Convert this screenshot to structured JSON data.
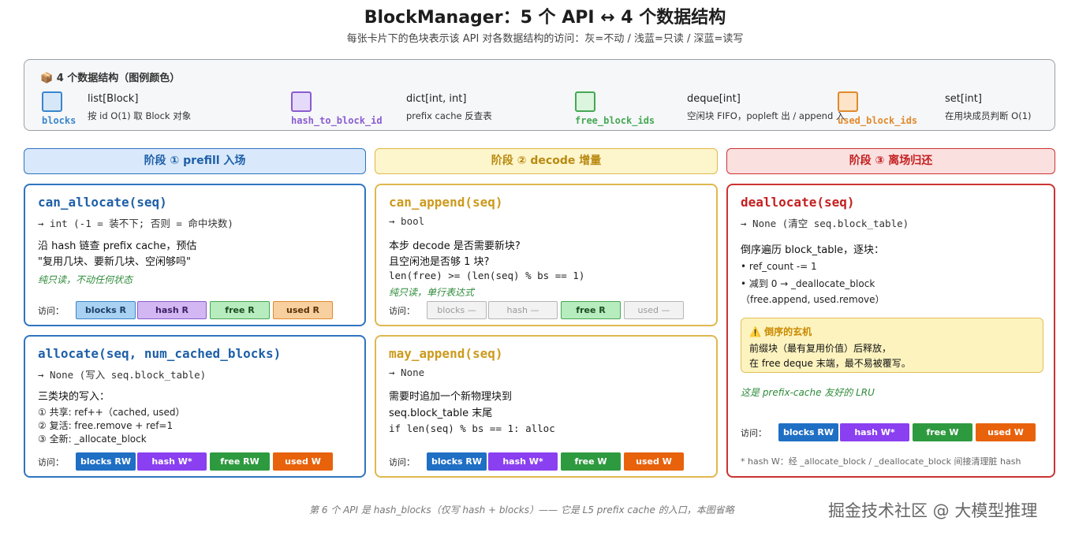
{
  "header": {
    "title": "BlockManager：5 个 API ↔ 4 个数据结构",
    "subtitle": "每张卡片下的色块表示该 API 对各数据结构的访问：灰=不动 / 浅蓝=只读 / 深蓝=读写"
  },
  "legend": {
    "title": "📦 4 个数据结构（图例颜色）",
    "items": [
      {
        "name": "blocks",
        "type": "list[Block]",
        "desc": "按 id O(1) 取 Block 对象",
        "color": "#3a86cc",
        "fill": "#d6e8f8"
      },
      {
        "name": "hash_to_block_id",
        "type": "dict[int, int]",
        "desc": "prefix cache 反查表",
        "color": "#8a5cd0",
        "fill": "#e6dafa"
      },
      {
        "name": "free_block_ids",
        "type": "deque[int]",
        "desc": "空闲块 FIFO，popleft 出 / append 入",
        "color": "#45a853",
        "fill": "#dcf5df"
      },
      {
        "name": "used_block_ids",
        "type": "set[int]",
        "desc": "在用块成员判断 O(1)",
        "color": "#e08a2c",
        "fill": "#fde3c8"
      }
    ]
  },
  "phases": [
    {
      "label": "阶段 ① prefill 入场",
      "color": "#2f74c0",
      "bg": "#d9e9fb",
      "text_color": "#1e5fa8"
    },
    {
      "label": "阶段 ② decode 增量",
      "color": "#e0b850",
      "bg": "#fdf5cc",
      "text_color": "#b98a12"
    },
    {
      "label": "阶段 ③ 离场归还",
      "color": "#cc3333",
      "bg": "#fbe0e0",
      "text_color": "#c42020"
    }
  ],
  "access_label": "访问：",
  "cards": {
    "can_allocate": {
      "fn": "can_allocate(seq)",
      "ret": "→ int (-1 = 装不下; 否则 = 命中块数)",
      "line1": "沿 hash 链查 prefix cache，预估",
      "line2": "\"复用几块、要新几块、空闲够吗\"",
      "note": "纯只读，不动任何状态",
      "chips": [
        "blocks R",
        "hash R",
        "free R",
        "used R"
      ]
    },
    "allocate": {
      "fn": "allocate(seq, num_cached_blocks)",
      "ret": "→ None (写入 seq.block_table)",
      "line1": "三类块的写入：",
      "items": [
        "① 共享: ref++（cached, used）",
        "② 复活: free.remove + ref=1",
        "③ 全新: _allocate_block"
      ],
      "chips": [
        "blocks RW",
        "hash W*",
        "free RW",
        "used W"
      ]
    },
    "can_append": {
      "fn": "can_append(seq)",
      "ret": "→ bool",
      "line1": "本步 decode 是否需要新块?",
      "line2": "且空闲池是否够 1 块?",
      "code": "len(free) >= (len(seq) % bs == 1)",
      "note": "纯只读，单行表达式",
      "chips": [
        "blocks —",
        "hash —",
        "free R",
        "used —"
      ]
    },
    "may_append": {
      "fn": "may_append(seq)",
      "ret": "→ None",
      "line1": "需要时追加一个新物理块到",
      "line2": "seq.block_table 末尾",
      "code": "if len(seq) % bs == 1: alloc",
      "chips": [
        "blocks RW",
        "hash W*",
        "free W",
        "used W"
      ]
    },
    "deallocate": {
      "fn": "deallocate(seq)",
      "ret": "→ None (清空 seq.block_table)",
      "line1": "倒序遍历 block_table，逐块：",
      "items": [
        "• ref_count -= 1",
        "• 减到 0 → _deallocate_block",
        "（free.append, used.remove）"
      ],
      "warn_title": "⚠️ 倒序的玄机",
      "warn_l1": "前缀块（最有复用价值）后释放，",
      "warn_l2": "在 free deque 末端，最不易被覆写。",
      "note": "这是 prefix-cache 友好的 LRU",
      "chips": [
        "blocks RW",
        "hash W*",
        "free W",
        "used W"
      ],
      "footnote": "* hash W：经 _allocate_block / _deallocate_block 间接清理脏 hash"
    }
  },
  "footer": "第 6 个 API 是 hash_blocks（仅写 hash + blocks）—— 它是 L5 prefix cache 的入口，本图省略",
  "watermark": "掘金技术社区 @ 大模型推理"
}
